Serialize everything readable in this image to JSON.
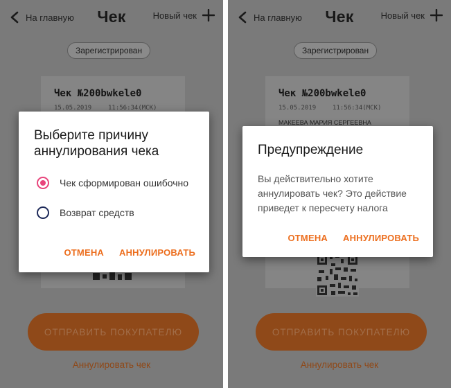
{
  "colors": {
    "accent": "#ec6e1e",
    "radio_selected": "#e8457c",
    "radio_unselected": "#1e2a5a",
    "overlay": "#7a7a7a"
  },
  "header": {
    "back_label": "На главную",
    "title": "Чек",
    "new_check_label": "Новый чек"
  },
  "status_badge": "Зарегистрирован",
  "receipt": {
    "title": "Чек №200bwkele0",
    "date": "15.05.2019",
    "time": "11:56:34(МСК)",
    "buyer": "МАКЕЕВА МАРИЯ СЕРГЕЕВНА"
  },
  "send_button": "ОТПРАВИТЬ ПОКУПАТЕЛЮ",
  "cancel_link": "Аннулировать чек",
  "reason_dialog": {
    "title": "Выберите причину аннулирования чека",
    "options": [
      {
        "label": "Чек сформирован ошибочно",
        "selected": true
      },
      {
        "label": "Возврат средств",
        "selected": false
      }
    ],
    "cancel": "ОТМЕНА",
    "confirm": "АННУЛИРОВАТЬ"
  },
  "warning_dialog": {
    "title": "Предупреждение",
    "message": "Вы действительно хотите аннулировать чек? Это действие приведет к пересчету налога",
    "cancel": "ОТМЕНА",
    "confirm": "АННУЛИРОВАТЬ"
  }
}
